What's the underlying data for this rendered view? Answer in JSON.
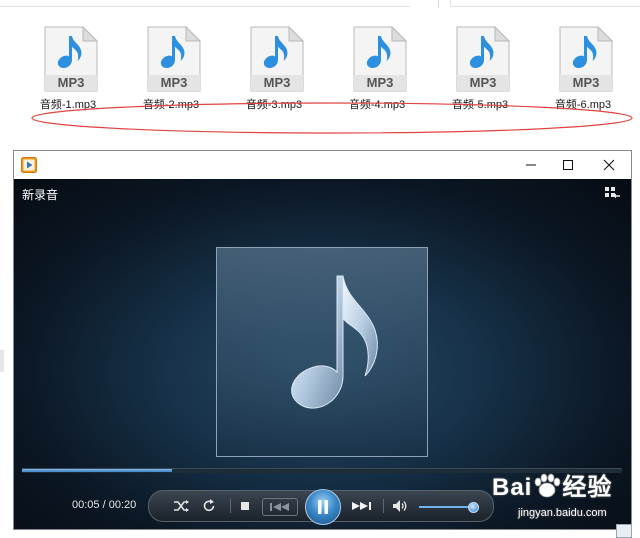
{
  "files": [
    {
      "name": "音频-1.mp3",
      "type_label": "MP3"
    },
    {
      "name": "音频-2.mp3",
      "type_label": "MP3"
    },
    {
      "name": "音频-3.mp3",
      "type_label": "MP3"
    },
    {
      "name": "音频-4.mp3",
      "type_label": "MP3"
    },
    {
      "name": "音频-5.mp3",
      "type_label": "MP3"
    },
    {
      "name": "音频-6.mp3",
      "type_label": "MP3"
    }
  ],
  "player": {
    "now_playing": "新录音",
    "time_current": "00:05",
    "time_separator": " / ",
    "time_total": "00:20",
    "seek_progress": 0.25,
    "volume": 0.9,
    "state": "playing"
  },
  "watermark": {
    "brand": "Bai",
    "brand_suffix": "经验",
    "url": "jingyan.baidu.com"
  },
  "colors": {
    "accent": "#3a89c9",
    "annotation_ellipse": "#e0433f",
    "app_icon": "#f19a22"
  }
}
